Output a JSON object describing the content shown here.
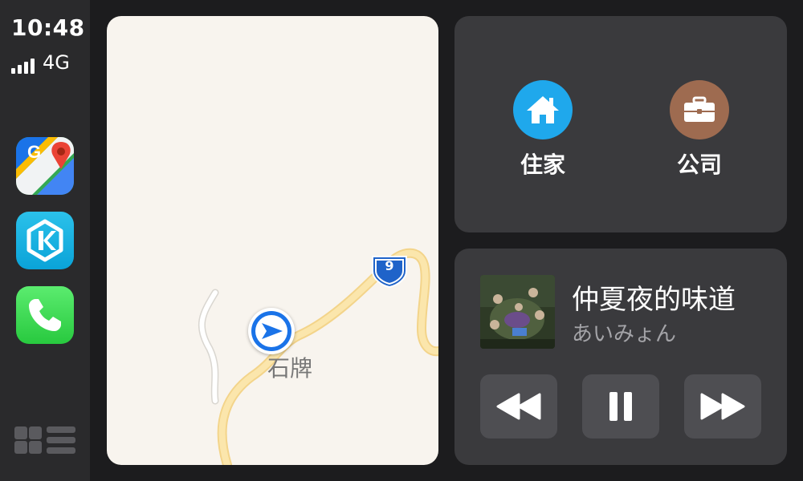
{
  "status": {
    "time": "10:48",
    "network": "4G",
    "signal_bars": 4
  },
  "sidebar": {
    "apps": [
      {
        "name": "Google Maps",
        "icon": "google-maps-icon"
      },
      {
        "name": "KKBOX",
        "icon": "kkbox-icon"
      },
      {
        "name": "Phone",
        "icon": "phone-icon"
      }
    ],
    "dashboard_toggle_icon": "dashboard-grid-icon"
  },
  "map": {
    "place_label": "石牌",
    "route_badge": "9",
    "current_location_icon": "navigation-arrow-icon"
  },
  "destinations": [
    {
      "label": "住家",
      "icon": "home-icon",
      "color": "#1fa8ec"
    },
    {
      "label": "公司",
      "icon": "briefcase-icon",
      "color": "#9e6b50"
    }
  ],
  "now_playing": {
    "title": "仲夏夜的味道",
    "artist": "あいみょん",
    "controls": [
      "rewind",
      "pause",
      "fast-forward"
    ]
  },
  "colors": {
    "background": "#1c1c1e",
    "card": "#3a3a3d",
    "button": "#4e4e52",
    "map": "#f8f4ee",
    "road": "#f7d98a",
    "accent_blue": "#1a73e8"
  }
}
